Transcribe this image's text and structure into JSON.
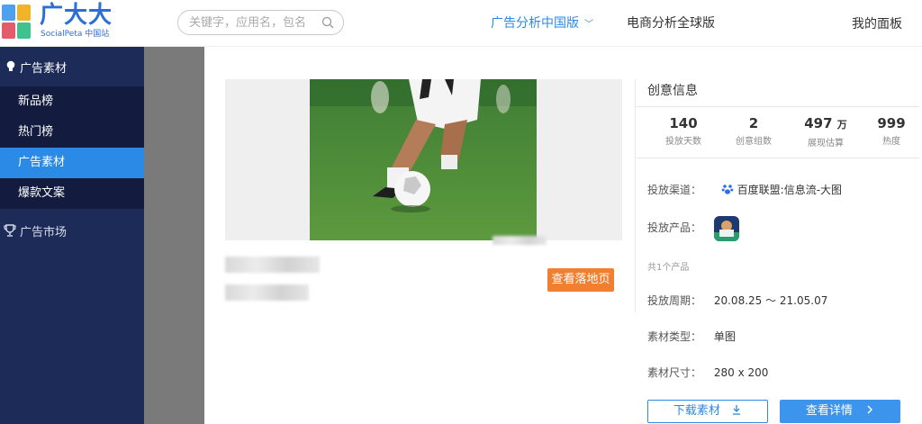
{
  "header": {
    "brand_name": "广大大",
    "brand_sub": "SocialPeta 中国站",
    "search_placeholder": "关键字，应用名，包名",
    "nav_cn": "广告分析中国版",
    "nav_global": "电商分析全球版",
    "nav_dashboard": "我的面板"
  },
  "sidebar": {
    "group1": "广告素材",
    "items": [
      "新品榜",
      "热门榜",
      "广告素材",
      "爆款文案"
    ],
    "active_index": 2,
    "group2": "广告市场"
  },
  "preview": {
    "landing_button": "查看落地页"
  },
  "info": {
    "title": "创意信息",
    "stats": [
      {
        "value": "140",
        "unit": "",
        "label": "投放天数"
      },
      {
        "value": "2",
        "unit": "",
        "label": "创意组数"
      },
      {
        "value": "497",
        "unit": "万",
        "label": "展现估算"
      },
      {
        "value": "999",
        "unit": "",
        "label": "热度"
      }
    ],
    "channel_label": "投放渠道：",
    "channel_value": "百度联盟:信息流-大图",
    "product_label": "投放产品：",
    "product_count": "共1个产品",
    "period_label": "投放周期：",
    "period_value": "20.08.25 ～ 21.05.07",
    "type_label": "素材类型：",
    "type_value": "单图",
    "size_label": "素材尺寸：",
    "size_value": "280 x 200",
    "download_button": "下载素材",
    "detail_button": "查看详情"
  },
  "colors": {
    "accent": "#2b8ae6",
    "sidebar_bg": "#1c2b57",
    "landing_btn": "#f07f30"
  }
}
